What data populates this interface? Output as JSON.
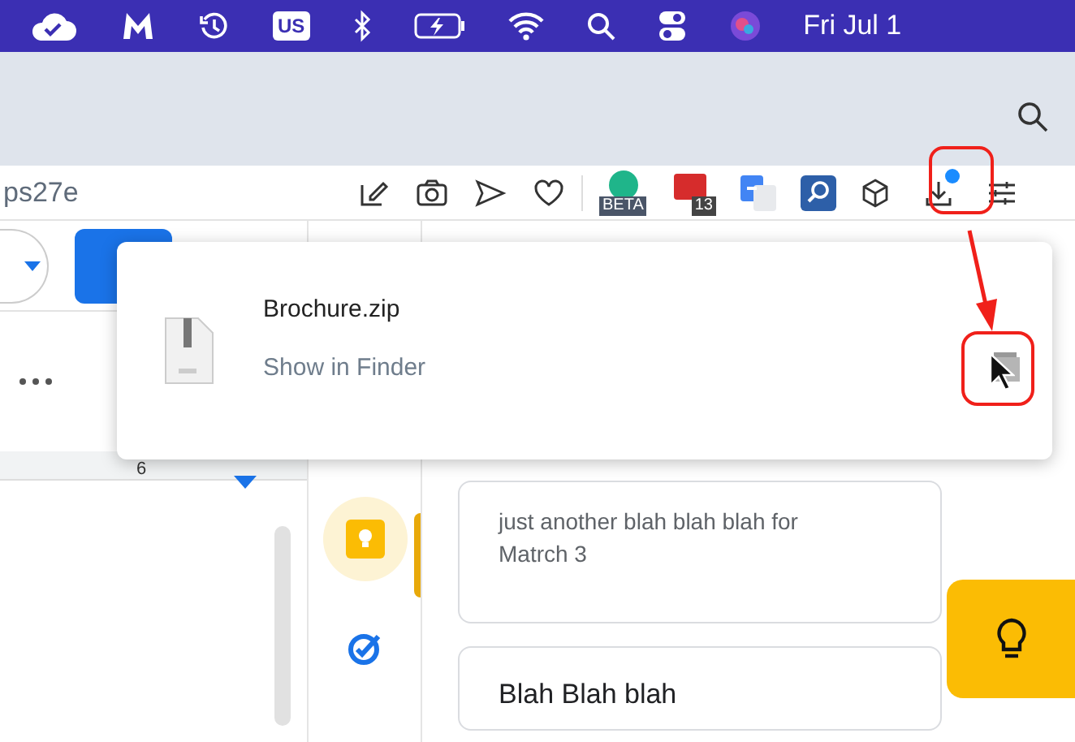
{
  "menu_bar": {
    "input_source": "US",
    "clock": "Fri Jul 1"
  },
  "toolbar": {
    "address_fragment": "ps27e",
    "extension_badges": [
      "BETA",
      "13"
    ]
  },
  "ruler": {
    "number": "6"
  },
  "download_popup": {
    "file_name": "Brochure.zip",
    "action": "Show in Finder"
  },
  "notes": [
    {
      "kind": "body",
      "text": "just another blah blah blah for Matrch 3"
    },
    {
      "kind": "title",
      "text": "Blah Blah blah"
    }
  ]
}
